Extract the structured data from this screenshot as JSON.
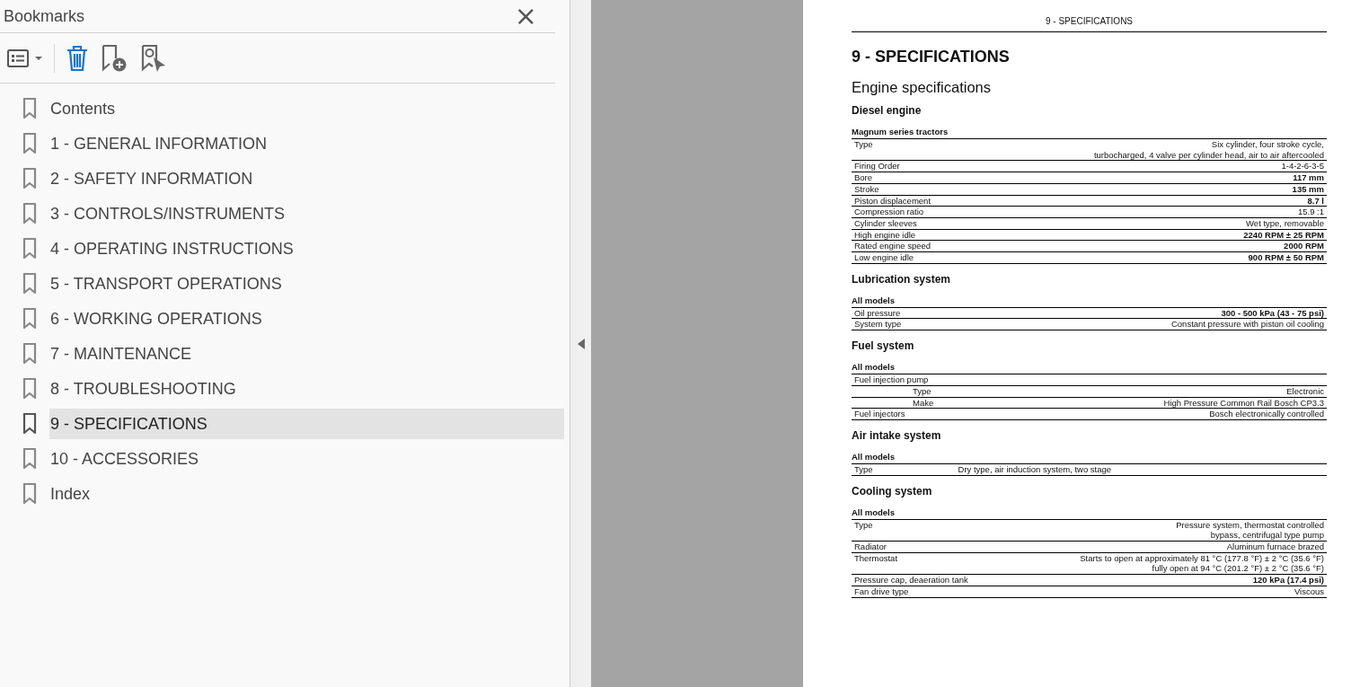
{
  "panel": {
    "title": "Bookmarks",
    "close": "×"
  },
  "bookmarks": [
    {
      "label": "Contents",
      "selected": false
    },
    {
      "label": "1 - GENERAL INFORMATION",
      "selected": false
    },
    {
      "label": "2 - SAFETY INFORMATION",
      "selected": false
    },
    {
      "label": "3 - CONTROLS/INSTRUMENTS",
      "selected": false
    },
    {
      "label": "4 - OPERATING INSTRUCTIONS",
      "selected": false
    },
    {
      "label": "5 - TRANSPORT OPERATIONS",
      "selected": false
    },
    {
      "label": "6 - WORKING OPERATIONS",
      "selected": false
    },
    {
      "label": "7 - MAINTENANCE",
      "selected": false
    },
    {
      "label": "8 - TROUBLESHOOTING",
      "selected": false
    },
    {
      "label": "9 - SPECIFICATIONS",
      "selected": true
    },
    {
      "label": "10 - ACCESSORIES",
      "selected": false
    },
    {
      "label": "Index",
      "selected": false
    }
  ],
  "document": {
    "page_header": "9 - SPECIFICATIONS",
    "title": "9 - SPECIFICATIONS",
    "subtitle": "Engine specifications",
    "sections": [
      {
        "heading": "Diesel engine",
        "group": "Magnum series tractors",
        "rows": [
          {
            "label": "Type",
            "value": [
              "Six cylinder, four stroke cycle,",
              "turbocharged, 4 valve per cylinder head, air to air aftercooled"
            ],
            "bold": false,
            "indented": false,
            "centered": false
          },
          {
            "label": "Firing Order",
            "value": [
              "1-4-2-6-3-5"
            ],
            "bold": false,
            "indented": false,
            "centered": false
          },
          {
            "label": "Bore",
            "value": [
              "117 mm"
            ],
            "bold": true,
            "indented": false,
            "centered": false
          },
          {
            "label": "Stroke",
            "value": [
              "135 mm"
            ],
            "bold": true,
            "indented": false,
            "centered": false
          },
          {
            "label": "Piston displacement",
            "value": [
              "8.7 l"
            ],
            "bold": true,
            "indented": false,
            "centered": false
          },
          {
            "label": "Compression ratio",
            "value": [
              "15.9 :1"
            ],
            "bold": false,
            "indented": false,
            "centered": false
          },
          {
            "label": "Cylinder sleeves",
            "value": [
              "Wet type, removable"
            ],
            "bold": false,
            "indented": false,
            "centered": false
          },
          {
            "label": "High engine idle",
            "value": [
              "2240 RPM ± 25 RPM"
            ],
            "bold": true,
            "indented": false,
            "centered": false
          },
          {
            "label": "Rated engine speed",
            "value": [
              "2000 RPM"
            ],
            "bold": true,
            "indented": false,
            "centered": false
          },
          {
            "label": "Low engine idle",
            "value": [
              "900 RPM ± 50 RPM"
            ],
            "bold": true,
            "indented": false,
            "centered": false
          }
        ]
      },
      {
        "heading": "Lubrication system",
        "group": "All models",
        "rows": [
          {
            "label": "Oil pressure",
            "value": [
              "300 - 500 kPa (43 - 75 psi)"
            ],
            "bold": true,
            "indented": false,
            "centered": false
          },
          {
            "label": "System type",
            "value": [
              "Constant pressure with piston oil cooling"
            ],
            "bold": false,
            "indented": false,
            "centered": false
          }
        ]
      },
      {
        "heading": "Fuel system",
        "group": "All models",
        "rows": [
          {
            "label": "Fuel injection pump",
            "value": [],
            "indented": false
          },
          {
            "label": "Type",
            "value": [
              "Electronic"
            ],
            "bold": false,
            "indented": true,
            "centered": false
          },
          {
            "label": "Make",
            "value": [
              "High Pressure Common Rail Bosch CP3.3"
            ],
            "bold": false,
            "indented": true,
            "centered": false
          },
          {
            "label": "Fuel injectors",
            "value": [
              "Bosch electronically controlled"
            ],
            "bold": false,
            "indented": false,
            "centered": false
          }
        ]
      },
      {
        "heading": "Air intake system",
        "group": "All models",
        "rows": [
          {
            "label": "Type",
            "value": [
              "Dry type, air induction system, two stage"
            ],
            "bold": false,
            "indented": false,
            "centered": true
          }
        ]
      },
      {
        "heading": "Cooling system",
        "group": "All models",
        "rows": [
          {
            "label": "Type",
            "value": [
              "Pressure system, thermostat controlled",
              "bypass, centrifugal type pump"
            ],
            "bold": false,
            "indented": false,
            "centered": false
          },
          {
            "label": "Radiator",
            "value": [
              "Aluminum furnace brazed"
            ],
            "bold": false,
            "indented": false,
            "centered": false
          },
          {
            "label": "Thermostat",
            "value": [
              "Starts to open at approximately 81 °C (177.8 °F) ± 2 °C (35.6 °F)",
              "fully open at 94 °C (201.2 °F) ± 2 °C (35.6 °F)"
            ],
            "bold": false,
            "indented": false,
            "centered": false
          },
          {
            "label": "Pressure cap, deaeration tank",
            "value": [
              "120 kPa (17.4 psi)"
            ],
            "bold": true,
            "indented": false,
            "centered": false
          },
          {
            "label": "Fan drive type",
            "value": [
              "Viscous"
            ],
            "bold": false,
            "indented": false,
            "centered": false
          }
        ]
      }
    ]
  }
}
